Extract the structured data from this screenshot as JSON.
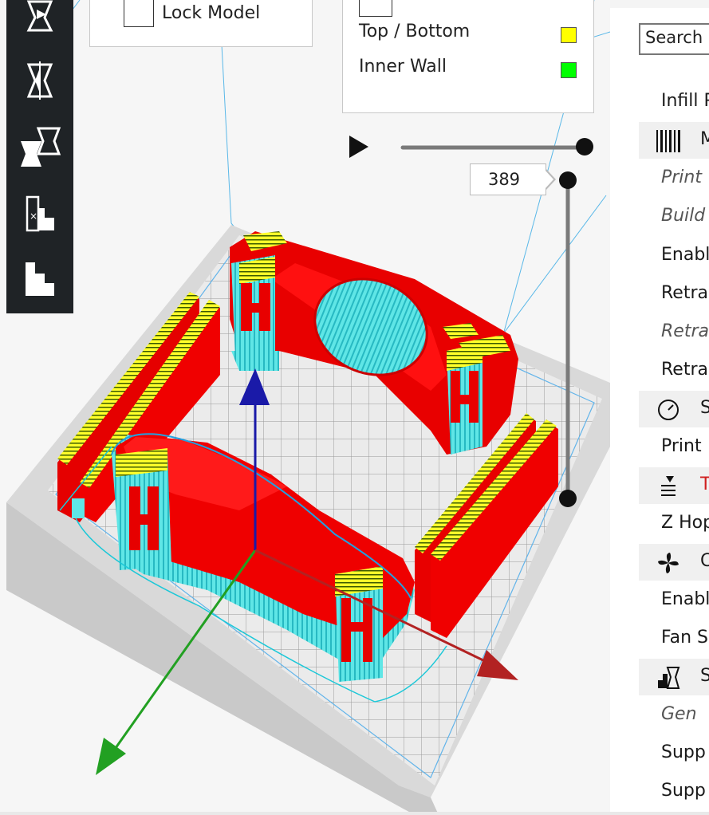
{
  "lock_panel": {
    "label": "Lock Model"
  },
  "legend": {
    "rows": [
      {
        "label": "Top / Bottom",
        "color": "#ffff00"
      },
      {
        "label": "Inner Wall",
        "color": "#00ff00"
      }
    ]
  },
  "layer_slider": {
    "current_layer": "389"
  },
  "toolbar": {
    "tools": [
      "move-tool",
      "scale-tool",
      "mirror-tool",
      "per-model-settings-tool",
      "support-blocker-tool"
    ]
  },
  "sidebar": {
    "search_label": "Search",
    "rows": [
      {
        "type": "row",
        "label": "Infill P"
      },
      {
        "type": "header",
        "icon": "material-icon",
        "label": "M"
      },
      {
        "type": "italic",
        "label": "Print"
      },
      {
        "type": "italic",
        "label": "Build"
      },
      {
        "type": "row",
        "label": "Enabl"
      },
      {
        "type": "row",
        "label": "Retra"
      },
      {
        "type": "italic",
        "label": "Retra"
      },
      {
        "type": "row",
        "label": "Retra"
      },
      {
        "type": "header",
        "icon": "speed-gauge-icon",
        "label": "S"
      },
      {
        "type": "row",
        "label": "Print"
      },
      {
        "type": "header",
        "icon": "travel-icon",
        "label": "T"
      },
      {
        "type": "row",
        "label": "Z Hop"
      },
      {
        "type": "header",
        "icon": "cooling-fan-icon",
        "label": "C"
      },
      {
        "type": "row",
        "label": "Enabl"
      },
      {
        "type": "row",
        "label": "Fan S"
      },
      {
        "type": "header",
        "icon": "support-icon",
        "label": "S"
      },
      {
        "type": "italic",
        "label": "Gen"
      },
      {
        "type": "row",
        "label": "Supp"
      },
      {
        "type": "row",
        "label": "Supp"
      }
    ]
  },
  "colors": {
    "model_red": "#ff0000",
    "top_yellow": "#ffff00",
    "support_cyan": "#44dddd",
    "toolbar_bg": "#1f2326",
    "axis_x": "#b22222",
    "axis_y": "#22a022",
    "axis_z": "#1a1aa8"
  }
}
